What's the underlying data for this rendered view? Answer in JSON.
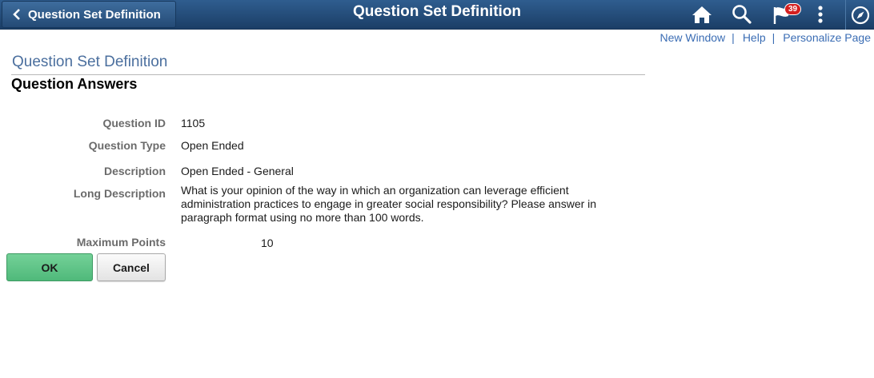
{
  "banner": {
    "back_label": "Question Set Definition",
    "title": "Question Set Definition",
    "notification_count": "39",
    "icons": [
      "chevron-left-icon",
      "home-icon",
      "search-icon",
      "flag-icon",
      "more-vertical-icon",
      "compass-icon"
    ]
  },
  "page_links": {
    "new_window": "New Window",
    "help": "Help",
    "personalize": "Personalize Page",
    "separator": "|"
  },
  "page_title": "Question Set Definition",
  "section_title": "Question Answers",
  "fields": {
    "question_id": {
      "label": "Question ID",
      "value": "1105"
    },
    "question_type": {
      "label": "Question Type",
      "value": "Open Ended"
    },
    "description": {
      "label": "Description",
      "value": "Open Ended - General"
    },
    "long_description": {
      "label": "Long Description",
      "value": "What is your opinion of the way in which an organization can leverage efficient administration practices to engage in greater social responsibility?  Please answer in paragraph format using no more than 100 words."
    },
    "maximum_points": {
      "label": "Maximum Points",
      "value": "10"
    }
  },
  "buttons": {
    "ok": "OK",
    "cancel": "Cancel"
  },
  "colors": {
    "banner": "#1b3e66",
    "link": "#3b6db4",
    "page_title": "#4b6f9e",
    "ok_button": "#5cc286",
    "badge": "#d42020"
  }
}
